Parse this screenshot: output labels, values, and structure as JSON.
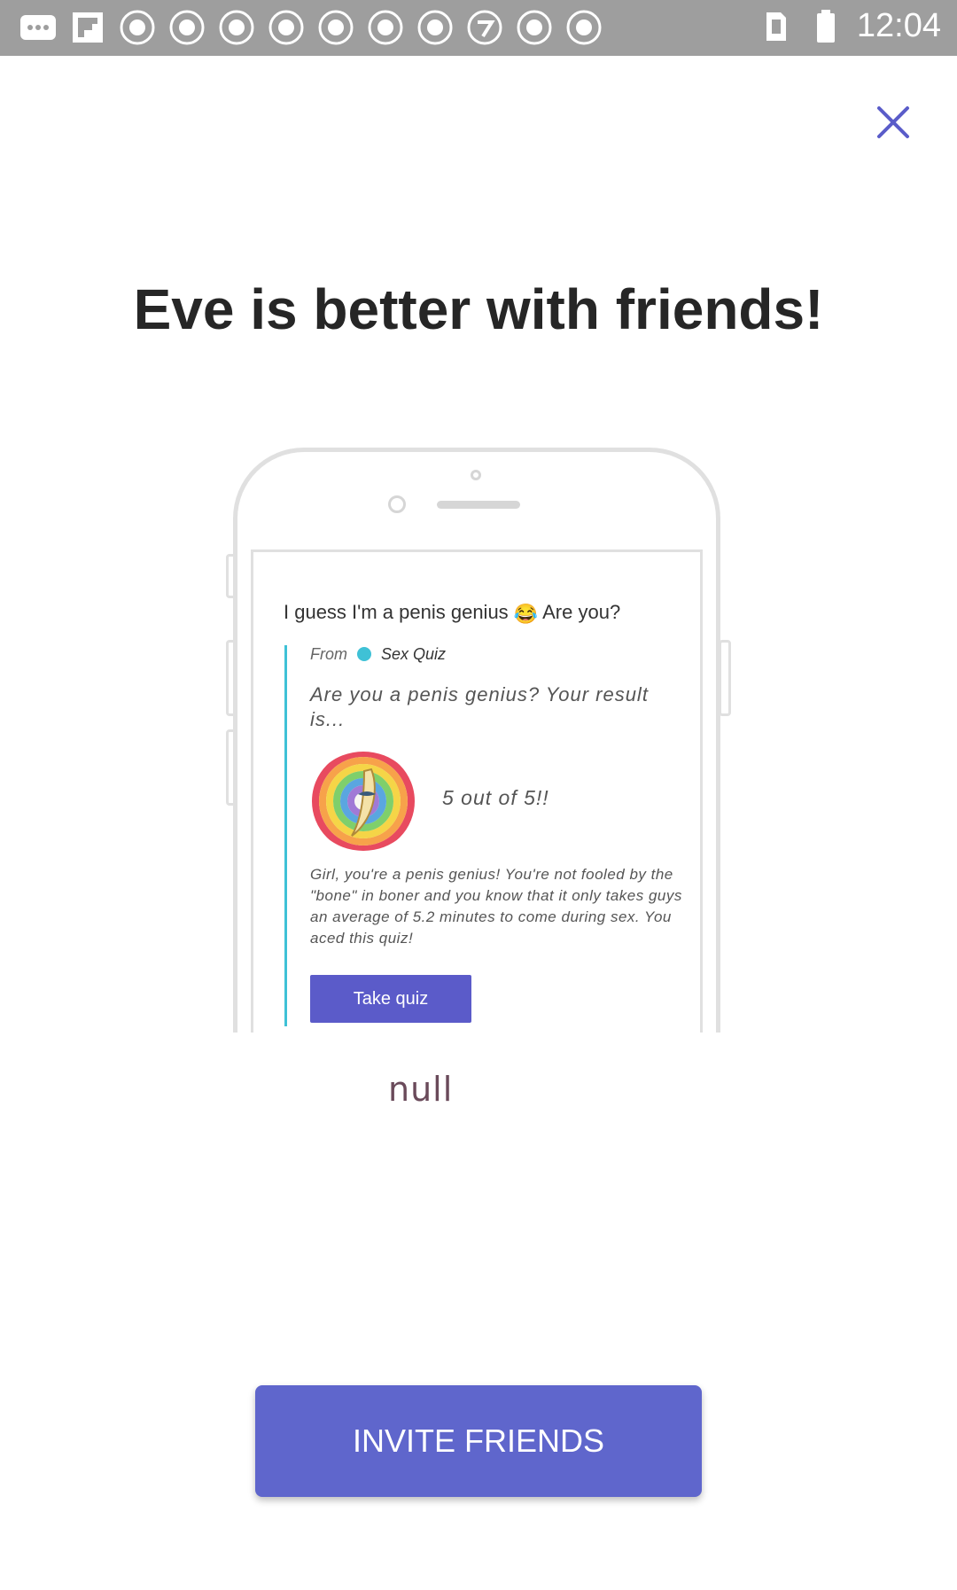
{
  "status_bar": {
    "time": "12:04",
    "icons": [
      "messages-icon",
      "flipboard-icon",
      "abc-news-icon",
      "abc-news-icon",
      "abc-news-icon",
      "abc-news-icon",
      "abc-news-icon",
      "abc-news-icon",
      "abc-news-icon",
      "abc7-icon",
      "abc-news-icon",
      "abc-news-icon",
      "sim-icon",
      "battery-icon"
    ]
  },
  "close": {
    "icon": "close-icon",
    "color": "#5a5cc9"
  },
  "title": "Eve is better with friends!",
  "illustration": {
    "message": "I guess I'm a penis genius",
    "message_suffix": "Are you?",
    "emoji": "😂",
    "from_label": "From",
    "quiz_name": "Sex Quiz",
    "question": "Are you a penis genius? Your result is...",
    "score": "5 out of 5!!",
    "body": "Girl, you're a penis genius! You're not fooled by the \"bone\" in boner and you know that it only takes guys an average of 5.2 minutes to come during sex. You aced this quiz!",
    "button": "Take quiz"
  },
  "null_text": "null",
  "invite_button": {
    "label": "INVITE FRIENDS",
    "color": "#5f66cc"
  }
}
